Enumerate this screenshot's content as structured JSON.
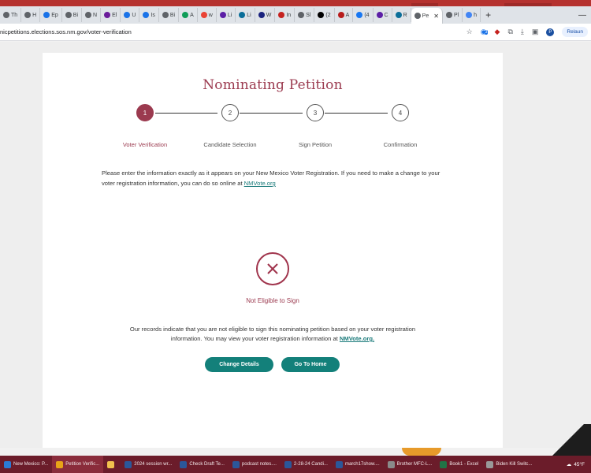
{
  "browser": {
    "tabs": [
      {
        "label": "Th",
        "color": "#5f6368"
      },
      {
        "label": "H",
        "color": "#5f6368"
      },
      {
        "label": "Ep",
        "color": "#1a73e8"
      },
      {
        "label": "Bi",
        "color": "#5f6368"
      },
      {
        "label": "N",
        "color": "#5f6368"
      },
      {
        "label": "El",
        "color": "#6a1b9a"
      },
      {
        "label": "U",
        "color": "#1a73e8"
      },
      {
        "label": "Is",
        "color": "#1a73e8"
      },
      {
        "label": "Bi",
        "color": "#5f6368"
      },
      {
        "label": "A",
        "color": "#0f9d58"
      },
      {
        "label": "w",
        "color": "#ea4335"
      },
      {
        "label": "Li",
        "color": "#5c1fa6"
      },
      {
        "label": "Li",
        "color": "#0b6e99"
      },
      {
        "label": "W",
        "color": "#1a237e"
      },
      {
        "label": "In",
        "color": "#c5221f"
      },
      {
        "label": "Sl",
        "color": "#5f6368"
      },
      {
        "label": "(2",
        "color": "#000000"
      },
      {
        "label": "A",
        "color": "#b71c1c"
      },
      {
        "label": "(4",
        "color": "#1877f2"
      },
      {
        "label": "C",
        "color": "#5c1fa6"
      },
      {
        "label": "R",
        "color": "#0b6e99"
      },
      {
        "label": "Pe",
        "color": "#5f6368",
        "active": true
      },
      {
        "label": "Pl",
        "color": "#5f6368"
      },
      {
        "label": "h",
        "color": "#4285f4"
      }
    ],
    "url": "nicpetitions.elections.sos.nm.gov/voter-verification",
    "relaunch_label": "Relaun",
    "profile_initial": "P",
    "extension_badge": "3"
  },
  "page": {
    "title": "Nominating Petition",
    "steps": [
      {
        "number": "1",
        "label": "Voter Verification",
        "active": true
      },
      {
        "number": "2",
        "label": "Candidate Selection",
        "active": false
      },
      {
        "number": "3",
        "label": "Sign Petition",
        "active": false
      },
      {
        "number": "4",
        "label": "Confirmation",
        "active": false
      }
    ],
    "instructions_text": "Please enter the information exactly as it appears on your New Mexico Voter Registration. If you need to make a change to your voter registration information, you can do so online at ",
    "instructions_link": "NMVote.org",
    "status_title": "Not Eligible to Sign",
    "status_message": "Our records indicate that you are not eligible to sign this nominating petition based on your voter registration information. You may view your voter registration information at ",
    "status_link": "NMVote.org.",
    "buttons": {
      "change_details": "Change Details",
      "go_home": "Go To Home"
    },
    "accent_color": "#9b3a4f",
    "button_color": "#13807a"
  },
  "taskbar": {
    "items": [
      {
        "label": "New Mexico: P...",
        "icon_color": "#2b7bd6"
      },
      {
        "label": "Petition Verific...",
        "icon_color": "#e8a317",
        "active": true
      },
      {
        "label": "",
        "icon_color": "#f2c14e"
      },
      {
        "label": "2024 session wr...",
        "icon_color": "#2b579a"
      },
      {
        "label": "Check Draft Te...",
        "icon_color": "#2b579a"
      },
      {
        "label": "podcast notes....",
        "icon_color": "#2b579a"
      },
      {
        "label": "2-28-24 Candi...",
        "icon_color": "#2b579a"
      },
      {
        "label": "march17show....",
        "icon_color": "#2b579a"
      },
      {
        "label": "Brother MFC-L...",
        "icon_color": "#8a8a8a"
      },
      {
        "label": "Book1 - Excel",
        "icon_color": "#217346"
      },
      {
        "label": "Biden Kill Switc...",
        "icon_color": "#999999"
      }
    ],
    "temperature": "45°F"
  }
}
